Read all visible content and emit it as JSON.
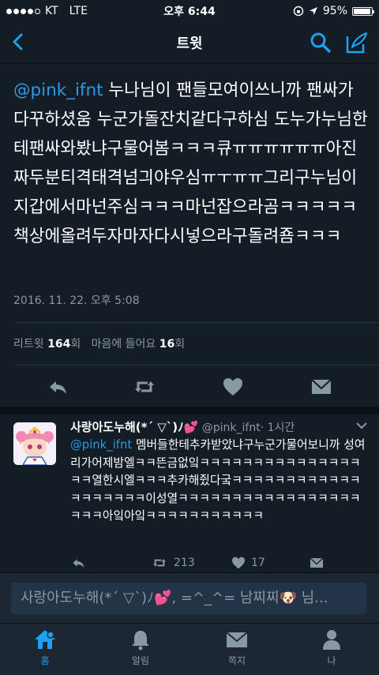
{
  "status": {
    "carrier": "KT",
    "network": "LTE",
    "time": "오후 6:44",
    "battery": "95%",
    "battery_level": 0.95,
    "signal_bars": 4
  },
  "nav": {
    "title": "트윗"
  },
  "tweet": {
    "mention": "@pink_ifnt",
    "body": " 누나님이 팬들모여이쓰니까 팬싸가다꾸하셨움 누군가돌잔치같다구하심 도누가누님한테팬싸와봤냐구물어봄ㅋㅋㅋ큐ㅠㅠㅠㅠㅠㅠ아진짜두분티격태격넘긔야우심ㅠㅜㅠㅠ그리구누님이지갑에서마넌주심ㅋㅋㅋ마넌잡으라곰ㅋㅋㅋㅋㅋ책상에올려두자마자다시넣으라구돌려죰ㅋㅋㅋ",
    "timestamp": "2016. 11. 22. 오후 5:08",
    "retweet_label": "리트윗",
    "retweet_count": "164",
    "count_unit": "회",
    "like_label": "마음에 들어요",
    "like_count": "16",
    "like_unit": "회"
  },
  "reply": {
    "name": "사랑아도누해(*´ ▽`)ﾉ💕",
    "handle": "@pink_ifnt",
    "time": "· 1시간",
    "mention": "@pink_ifnt",
    "body": " 멤버들한테추카받았냐구누군가물어보니까 성여리가어제밤엘ㅋㅋ뜬금없잌ㅋㅋㅋㅋㅋㅋㅋㅋㅋㅋㅋㅋㅋㅋㅋㅋㅋ열한시엘ㅋㅋㅋ추카해쥤다궄ㅋㅋㅋㅋㅋㅋㅋㅋㅋㅋㅋㅋㅋㅋㅋㅋㅋㅋㅋ이성열ㅋㅋㅋㅋㅋㅋㅋㅋㅋㅋㅋㅋㅋㅋㅋㅋㅋㅋㅋㅋ아잌아잌ㅋㅋㅋㅋㅋㅋㅋㅋㅋㅋㅋ",
    "retweets": "213",
    "likes": "17"
  },
  "compose": {
    "placeholder": "사랑아도누해(*´ ▽`)ﾉ💕, =^_^= 남찌찌🐶 님..."
  },
  "tabs": [
    {
      "label": "홈",
      "icon": "home-icon",
      "active": true
    },
    {
      "label": "알림",
      "icon": "bell-icon",
      "active": false
    },
    {
      "label": "쪽지",
      "icon": "envelope-icon",
      "active": false
    },
    {
      "label": "나",
      "icon": "person-icon",
      "active": false
    }
  ],
  "colors": {
    "accent": "#1da1f2",
    "background": "#141d26",
    "muted": "#8899a6"
  }
}
